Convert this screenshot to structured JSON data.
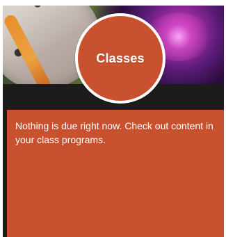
{
  "header": {
    "circle_title": "Classes"
  },
  "content": {
    "message": "Nothing is due right now. Check out content in your class programs."
  },
  "colors": {
    "accent": "#c8522f",
    "frame": "#1c1c1c",
    "text": "#ffffff"
  }
}
